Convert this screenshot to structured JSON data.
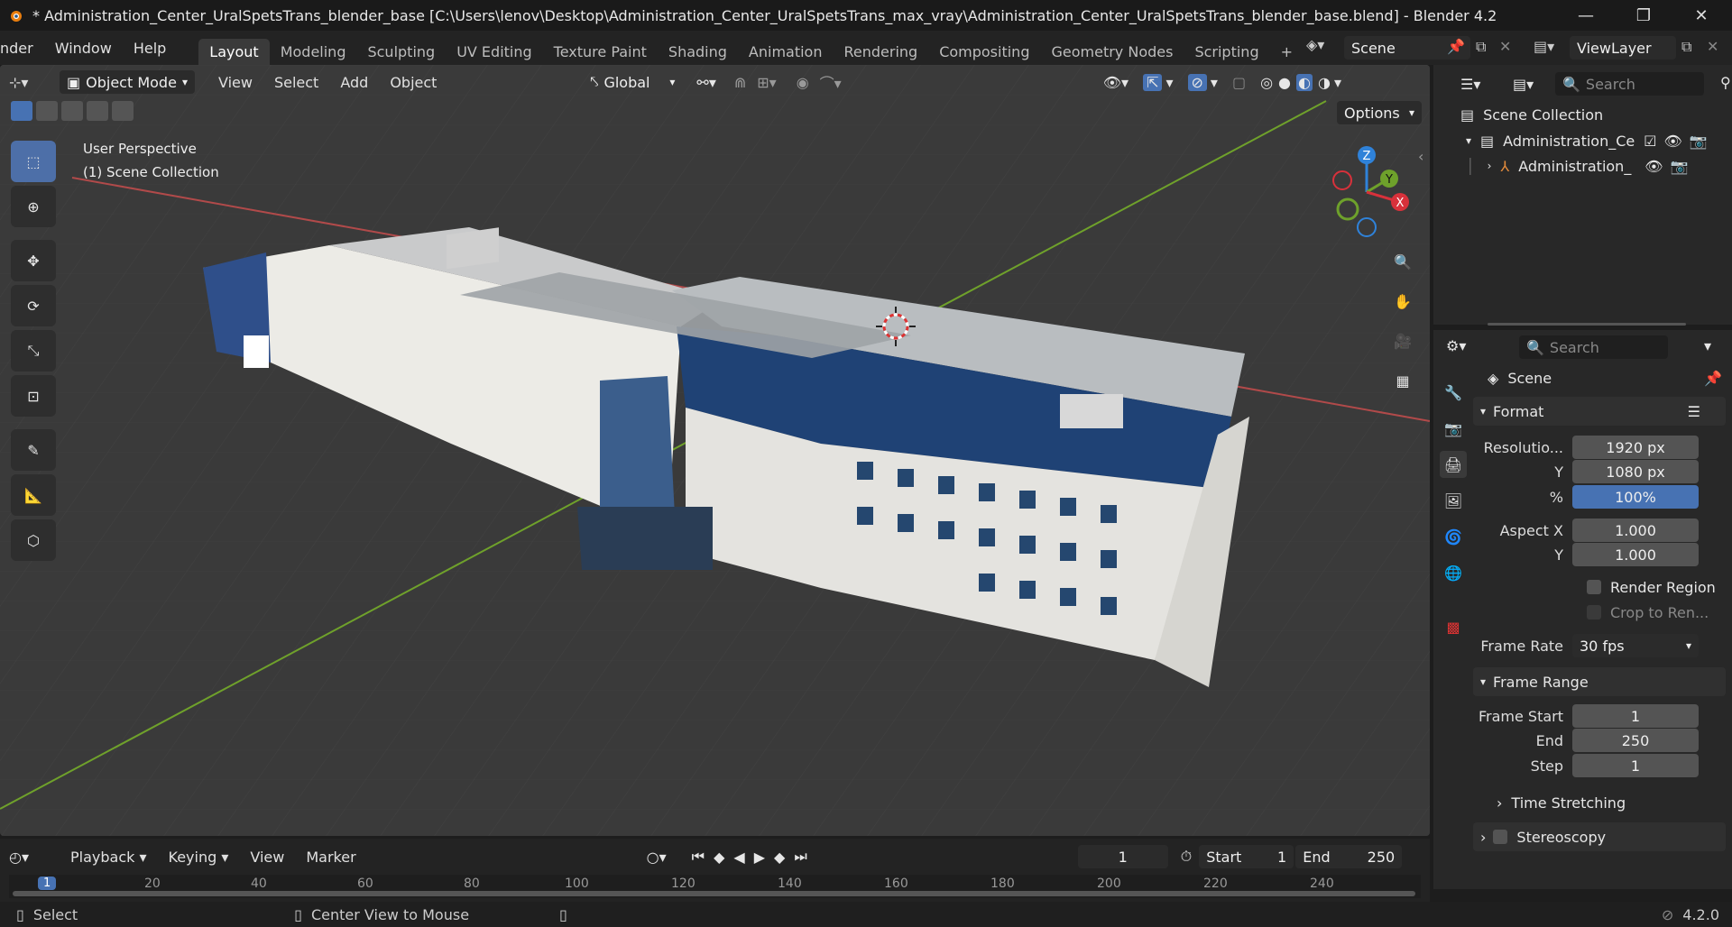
{
  "window": {
    "title": "* Administration_Center_UralSpetsTrans_blender_base [C:\\Users\\lenov\\Desktop\\Administration_Center_UralSpetsTrans_max_vray\\Administration_Center_UralSpetsTrans_blender_base.blend] - Blender 4.2"
  },
  "menu": {
    "items": [
      "nder",
      "Window",
      "Help"
    ],
    "workspaces": [
      "Layout",
      "Modeling",
      "Sculpting",
      "UV Editing",
      "Texture Paint",
      "Shading",
      "Animation",
      "Rendering",
      "Compositing",
      "Geometry Nodes",
      "Scripting"
    ],
    "add_tab": "+",
    "scene": "Scene",
    "view_layer": "ViewLayer"
  },
  "viewport_header": {
    "mode": "Object Mode",
    "menus": [
      "View",
      "Select",
      "Add",
      "Object"
    ],
    "orientation": "Global",
    "options": "Options"
  },
  "viewport": {
    "perspective": "User Perspective",
    "collection": "(1) Scene Collection",
    "gizmo": {
      "z": "Z",
      "y": "Y",
      "x": "X"
    }
  },
  "outliner": {
    "search_placeholder": "Search",
    "root": "Scene Collection",
    "items": [
      {
        "label": "Administration_Ce"
      },
      {
        "label": "Administration_"
      }
    ]
  },
  "properties": {
    "search_placeholder": "Search",
    "context": "Scene",
    "format": {
      "header": "Format",
      "resolution_x_label": "Resolutio...",
      "resolution_x": "1920 px",
      "resolution_y_label": "Y",
      "resolution_y": "1080 px",
      "percent_label": "%",
      "percent": "100%",
      "aspect_x_label": "Aspect X",
      "aspect_x": "1.000",
      "aspect_y_label": "Y",
      "aspect_y": "1.000",
      "render_region": "Render Region",
      "crop": "Crop to Ren...",
      "frame_rate_label": "Frame Rate",
      "frame_rate": "30 fps"
    },
    "frame_range": {
      "header": "Frame Range",
      "start_label": "Frame Start",
      "start": "1",
      "end_label": "End",
      "end": "250",
      "step_label": "Step",
      "step": "1"
    },
    "time_stretching": "Time Stretching",
    "stereoscopy": "Stereoscopy"
  },
  "timeline": {
    "menus": [
      "Playback",
      "Keying",
      "View",
      "Marker"
    ],
    "current_frame": "1",
    "start_label": "Start",
    "start": "1",
    "end_label": "End",
    "end": "250",
    "ruler": [
      "20",
      "40",
      "60",
      "80",
      "100",
      "120",
      "140",
      "160",
      "180",
      "200",
      "220",
      "240"
    ],
    "playhead": "1"
  },
  "status": {
    "select": "Select",
    "center_view": "Center View to Mouse",
    "version": "4.2.0"
  },
  "colors": {
    "accent": "#4772b3",
    "bg": "#393939",
    "axis_x": "#c0403f",
    "axis_y": "#6ea12b"
  }
}
